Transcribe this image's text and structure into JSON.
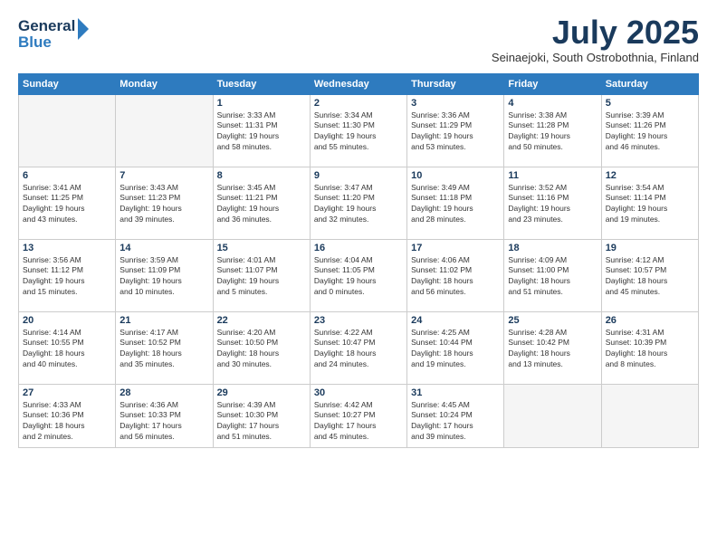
{
  "logo": {
    "line1": "General",
    "line2": "Blue"
  },
  "header": {
    "title": "July 2025",
    "subtitle": "Seinaejoki, South Ostrobothnia, Finland"
  },
  "weekdays": [
    "Sunday",
    "Monday",
    "Tuesday",
    "Wednesday",
    "Thursday",
    "Friday",
    "Saturday"
  ],
  "weeks": [
    [
      {
        "num": "",
        "info": ""
      },
      {
        "num": "",
        "info": ""
      },
      {
        "num": "1",
        "info": "Sunrise: 3:33 AM\nSunset: 11:31 PM\nDaylight: 19 hours\nand 58 minutes."
      },
      {
        "num": "2",
        "info": "Sunrise: 3:34 AM\nSunset: 11:30 PM\nDaylight: 19 hours\nand 55 minutes."
      },
      {
        "num": "3",
        "info": "Sunrise: 3:36 AM\nSunset: 11:29 PM\nDaylight: 19 hours\nand 53 minutes."
      },
      {
        "num": "4",
        "info": "Sunrise: 3:38 AM\nSunset: 11:28 PM\nDaylight: 19 hours\nand 50 minutes."
      },
      {
        "num": "5",
        "info": "Sunrise: 3:39 AM\nSunset: 11:26 PM\nDaylight: 19 hours\nand 46 minutes."
      }
    ],
    [
      {
        "num": "6",
        "info": "Sunrise: 3:41 AM\nSunset: 11:25 PM\nDaylight: 19 hours\nand 43 minutes."
      },
      {
        "num": "7",
        "info": "Sunrise: 3:43 AM\nSunset: 11:23 PM\nDaylight: 19 hours\nand 39 minutes."
      },
      {
        "num": "8",
        "info": "Sunrise: 3:45 AM\nSunset: 11:21 PM\nDaylight: 19 hours\nand 36 minutes."
      },
      {
        "num": "9",
        "info": "Sunrise: 3:47 AM\nSunset: 11:20 PM\nDaylight: 19 hours\nand 32 minutes."
      },
      {
        "num": "10",
        "info": "Sunrise: 3:49 AM\nSunset: 11:18 PM\nDaylight: 19 hours\nand 28 minutes."
      },
      {
        "num": "11",
        "info": "Sunrise: 3:52 AM\nSunset: 11:16 PM\nDaylight: 19 hours\nand 23 minutes."
      },
      {
        "num": "12",
        "info": "Sunrise: 3:54 AM\nSunset: 11:14 PM\nDaylight: 19 hours\nand 19 minutes."
      }
    ],
    [
      {
        "num": "13",
        "info": "Sunrise: 3:56 AM\nSunset: 11:12 PM\nDaylight: 19 hours\nand 15 minutes."
      },
      {
        "num": "14",
        "info": "Sunrise: 3:59 AM\nSunset: 11:09 PM\nDaylight: 19 hours\nand 10 minutes."
      },
      {
        "num": "15",
        "info": "Sunrise: 4:01 AM\nSunset: 11:07 PM\nDaylight: 19 hours\nand 5 minutes."
      },
      {
        "num": "16",
        "info": "Sunrise: 4:04 AM\nSunset: 11:05 PM\nDaylight: 19 hours\nand 0 minutes."
      },
      {
        "num": "17",
        "info": "Sunrise: 4:06 AM\nSunset: 11:02 PM\nDaylight: 18 hours\nand 56 minutes."
      },
      {
        "num": "18",
        "info": "Sunrise: 4:09 AM\nSunset: 11:00 PM\nDaylight: 18 hours\nand 51 minutes."
      },
      {
        "num": "19",
        "info": "Sunrise: 4:12 AM\nSunset: 10:57 PM\nDaylight: 18 hours\nand 45 minutes."
      }
    ],
    [
      {
        "num": "20",
        "info": "Sunrise: 4:14 AM\nSunset: 10:55 PM\nDaylight: 18 hours\nand 40 minutes."
      },
      {
        "num": "21",
        "info": "Sunrise: 4:17 AM\nSunset: 10:52 PM\nDaylight: 18 hours\nand 35 minutes."
      },
      {
        "num": "22",
        "info": "Sunrise: 4:20 AM\nSunset: 10:50 PM\nDaylight: 18 hours\nand 30 minutes."
      },
      {
        "num": "23",
        "info": "Sunrise: 4:22 AM\nSunset: 10:47 PM\nDaylight: 18 hours\nand 24 minutes."
      },
      {
        "num": "24",
        "info": "Sunrise: 4:25 AM\nSunset: 10:44 PM\nDaylight: 18 hours\nand 19 minutes."
      },
      {
        "num": "25",
        "info": "Sunrise: 4:28 AM\nSunset: 10:42 PM\nDaylight: 18 hours\nand 13 minutes."
      },
      {
        "num": "26",
        "info": "Sunrise: 4:31 AM\nSunset: 10:39 PM\nDaylight: 18 hours\nand 8 minutes."
      }
    ],
    [
      {
        "num": "27",
        "info": "Sunrise: 4:33 AM\nSunset: 10:36 PM\nDaylight: 18 hours\nand 2 minutes."
      },
      {
        "num": "28",
        "info": "Sunrise: 4:36 AM\nSunset: 10:33 PM\nDaylight: 17 hours\nand 56 minutes."
      },
      {
        "num": "29",
        "info": "Sunrise: 4:39 AM\nSunset: 10:30 PM\nDaylight: 17 hours\nand 51 minutes."
      },
      {
        "num": "30",
        "info": "Sunrise: 4:42 AM\nSunset: 10:27 PM\nDaylight: 17 hours\nand 45 minutes."
      },
      {
        "num": "31",
        "info": "Sunrise: 4:45 AM\nSunset: 10:24 PM\nDaylight: 17 hours\nand 39 minutes."
      },
      {
        "num": "",
        "info": ""
      },
      {
        "num": "",
        "info": ""
      }
    ]
  ]
}
